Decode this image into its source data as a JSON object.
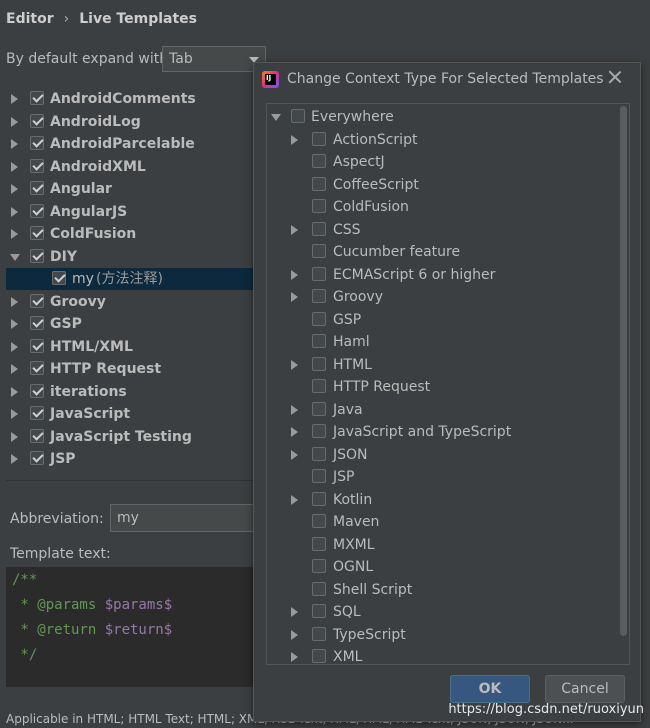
{
  "breadcrumb": {
    "parent": "Editor",
    "separator": "›",
    "current": "Live Templates"
  },
  "expand": {
    "label": "By default expand with",
    "value": "Tab"
  },
  "templates": [
    {
      "label": "AndroidComments",
      "expanded": false,
      "checked": true
    },
    {
      "label": "AndroidLog",
      "expanded": false,
      "checked": true
    },
    {
      "label": "AndroidParcelable",
      "expanded": false,
      "checked": true
    },
    {
      "label": "AndroidXML",
      "expanded": false,
      "checked": true
    },
    {
      "label": "Angular",
      "expanded": false,
      "checked": true
    },
    {
      "label": "AngularJS",
      "expanded": false,
      "checked": true
    },
    {
      "label": "ColdFusion",
      "expanded": false,
      "checked": true
    },
    {
      "label": "DIY",
      "expanded": true,
      "checked": true
    },
    {
      "label": "my",
      "desc": "(方法注释)",
      "child": true,
      "checked": true,
      "selected": true
    },
    {
      "label": "Groovy",
      "expanded": false,
      "checked": true
    },
    {
      "label": "GSP",
      "expanded": false,
      "checked": true
    },
    {
      "label": "HTML/XML",
      "expanded": false,
      "checked": true
    },
    {
      "label": "HTTP Request",
      "expanded": false,
      "checked": true
    },
    {
      "label": "iterations",
      "expanded": false,
      "checked": true
    },
    {
      "label": "JavaScript",
      "expanded": false,
      "checked": true
    },
    {
      "label": "JavaScript Testing",
      "expanded": false,
      "checked": true
    },
    {
      "label": "JSP",
      "expanded": false,
      "checked": true
    }
  ],
  "abbreviation": {
    "label": "Abbreviation:",
    "value": "my"
  },
  "template_text": {
    "label": "Template text:",
    "lines": [
      {
        "plain": "/**",
        "var": ""
      },
      {
        "plain": " * @params ",
        "var": "$params$"
      },
      {
        "plain": " * @return ",
        "var": "$return$"
      },
      {
        "plain": " */",
        "var": ""
      }
    ]
  },
  "applicable": "Applicable in HTML; HTML Text; HTML; XML; XSL Text; XML; XML; XML Text; JSON; JSON; JSON...",
  "dialog": {
    "title": "Change Context Type For Selected Templates",
    "root": {
      "label": "Everywhere",
      "expanded": true,
      "checked": false
    },
    "contexts": [
      {
        "label": "ActionScript",
        "expandable": true
      },
      {
        "label": "AspectJ",
        "expandable": false
      },
      {
        "label": "CoffeeScript",
        "expandable": false
      },
      {
        "label": "ColdFusion",
        "expandable": false
      },
      {
        "label": "CSS",
        "expandable": true
      },
      {
        "label": "Cucumber feature",
        "expandable": false
      },
      {
        "label": "ECMAScript 6 or higher",
        "expandable": true
      },
      {
        "label": "Groovy",
        "expandable": true
      },
      {
        "label": "GSP",
        "expandable": false
      },
      {
        "label": "Haml",
        "expandable": false
      },
      {
        "label": "HTML",
        "expandable": true
      },
      {
        "label": "HTTP Request",
        "expandable": false
      },
      {
        "label": "Java",
        "expandable": true
      },
      {
        "label": "JavaScript and TypeScript",
        "expandable": true
      },
      {
        "label": "JSON",
        "expandable": true
      },
      {
        "label": "JSP",
        "expandable": false
      },
      {
        "label": "Kotlin",
        "expandable": true
      },
      {
        "label": "Maven",
        "expandable": false
      },
      {
        "label": "MXML",
        "expandable": false
      },
      {
        "label": "OGNL",
        "expandable": false
      },
      {
        "label": "Shell Script",
        "expandable": false
      },
      {
        "label": "SQL",
        "expandable": true
      },
      {
        "label": "TypeScript",
        "expandable": true
      },
      {
        "label": "XML",
        "expandable": true
      }
    ],
    "ok_label": "OK",
    "cancel_label": "Cancel"
  },
  "watermark": "https://blog.csdn.net/ruoxiyun"
}
